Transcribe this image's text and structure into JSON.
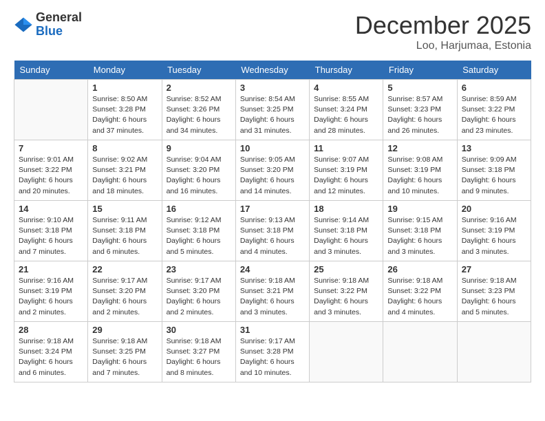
{
  "header": {
    "logo": {
      "general": "General",
      "blue": "Blue"
    },
    "title": "December 2025",
    "location": "Loo, Harjumaa, Estonia"
  },
  "weekdays": [
    "Sunday",
    "Monday",
    "Tuesday",
    "Wednesday",
    "Thursday",
    "Friday",
    "Saturday"
  ],
  "weeks": [
    [
      {
        "day": "",
        "info": ""
      },
      {
        "day": "1",
        "info": "Sunrise: 8:50 AM\nSunset: 3:28 PM\nDaylight: 6 hours\nand 37 minutes."
      },
      {
        "day": "2",
        "info": "Sunrise: 8:52 AM\nSunset: 3:26 PM\nDaylight: 6 hours\nand 34 minutes."
      },
      {
        "day": "3",
        "info": "Sunrise: 8:54 AM\nSunset: 3:25 PM\nDaylight: 6 hours\nand 31 minutes."
      },
      {
        "day": "4",
        "info": "Sunrise: 8:55 AM\nSunset: 3:24 PM\nDaylight: 6 hours\nand 28 minutes."
      },
      {
        "day": "5",
        "info": "Sunrise: 8:57 AM\nSunset: 3:23 PM\nDaylight: 6 hours\nand 26 minutes."
      },
      {
        "day": "6",
        "info": "Sunrise: 8:59 AM\nSunset: 3:22 PM\nDaylight: 6 hours\nand 23 minutes."
      }
    ],
    [
      {
        "day": "7",
        "info": "Sunrise: 9:01 AM\nSunset: 3:22 PM\nDaylight: 6 hours\nand 20 minutes."
      },
      {
        "day": "8",
        "info": "Sunrise: 9:02 AM\nSunset: 3:21 PM\nDaylight: 6 hours\nand 18 minutes."
      },
      {
        "day": "9",
        "info": "Sunrise: 9:04 AM\nSunset: 3:20 PM\nDaylight: 6 hours\nand 16 minutes."
      },
      {
        "day": "10",
        "info": "Sunrise: 9:05 AM\nSunset: 3:20 PM\nDaylight: 6 hours\nand 14 minutes."
      },
      {
        "day": "11",
        "info": "Sunrise: 9:07 AM\nSunset: 3:19 PM\nDaylight: 6 hours\nand 12 minutes."
      },
      {
        "day": "12",
        "info": "Sunrise: 9:08 AM\nSunset: 3:19 PM\nDaylight: 6 hours\nand 10 minutes."
      },
      {
        "day": "13",
        "info": "Sunrise: 9:09 AM\nSunset: 3:18 PM\nDaylight: 6 hours\nand 9 minutes."
      }
    ],
    [
      {
        "day": "14",
        "info": "Sunrise: 9:10 AM\nSunset: 3:18 PM\nDaylight: 6 hours\nand 7 minutes."
      },
      {
        "day": "15",
        "info": "Sunrise: 9:11 AM\nSunset: 3:18 PM\nDaylight: 6 hours\nand 6 minutes."
      },
      {
        "day": "16",
        "info": "Sunrise: 9:12 AM\nSunset: 3:18 PM\nDaylight: 6 hours\nand 5 minutes."
      },
      {
        "day": "17",
        "info": "Sunrise: 9:13 AM\nSunset: 3:18 PM\nDaylight: 6 hours\nand 4 minutes."
      },
      {
        "day": "18",
        "info": "Sunrise: 9:14 AM\nSunset: 3:18 PM\nDaylight: 6 hours\nand 3 minutes."
      },
      {
        "day": "19",
        "info": "Sunrise: 9:15 AM\nSunset: 3:18 PM\nDaylight: 6 hours\nand 3 minutes."
      },
      {
        "day": "20",
        "info": "Sunrise: 9:16 AM\nSunset: 3:19 PM\nDaylight: 6 hours\nand 3 minutes."
      }
    ],
    [
      {
        "day": "21",
        "info": "Sunrise: 9:16 AM\nSunset: 3:19 PM\nDaylight: 6 hours\nand 2 minutes."
      },
      {
        "day": "22",
        "info": "Sunrise: 9:17 AM\nSunset: 3:20 PM\nDaylight: 6 hours\nand 2 minutes."
      },
      {
        "day": "23",
        "info": "Sunrise: 9:17 AM\nSunset: 3:20 PM\nDaylight: 6 hours\nand 2 minutes."
      },
      {
        "day": "24",
        "info": "Sunrise: 9:18 AM\nSunset: 3:21 PM\nDaylight: 6 hours\nand 3 minutes."
      },
      {
        "day": "25",
        "info": "Sunrise: 9:18 AM\nSunset: 3:22 PM\nDaylight: 6 hours\nand 3 minutes."
      },
      {
        "day": "26",
        "info": "Sunrise: 9:18 AM\nSunset: 3:22 PM\nDaylight: 6 hours\nand 4 minutes."
      },
      {
        "day": "27",
        "info": "Sunrise: 9:18 AM\nSunset: 3:23 PM\nDaylight: 6 hours\nand 5 minutes."
      }
    ],
    [
      {
        "day": "28",
        "info": "Sunrise: 9:18 AM\nSunset: 3:24 PM\nDaylight: 6 hours\nand 6 minutes."
      },
      {
        "day": "29",
        "info": "Sunrise: 9:18 AM\nSunset: 3:25 PM\nDaylight: 6 hours\nand 7 minutes."
      },
      {
        "day": "30",
        "info": "Sunrise: 9:18 AM\nSunset: 3:27 PM\nDaylight: 6 hours\nand 8 minutes."
      },
      {
        "day": "31",
        "info": "Sunrise: 9:17 AM\nSunset: 3:28 PM\nDaylight: 6 hours\nand 10 minutes."
      },
      {
        "day": "",
        "info": ""
      },
      {
        "day": "",
        "info": ""
      },
      {
        "day": "",
        "info": ""
      }
    ]
  ]
}
